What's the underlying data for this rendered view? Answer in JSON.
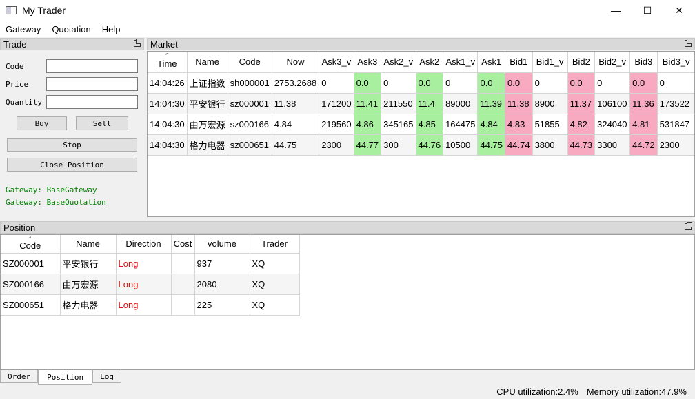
{
  "window": {
    "title": "My Trader",
    "minimize": "—",
    "maximize": "☐",
    "close": "✕"
  },
  "menu": [
    "Gateway",
    "Quotation",
    "Help"
  ],
  "trade": {
    "title": "Trade",
    "code_label": "Code",
    "price_label": "Price",
    "quantity_label": "Quantity",
    "code_value": "",
    "price_value": "",
    "quantity_value": "",
    "buy_label": "Buy",
    "sell_label": "Sell",
    "stop_label": "Stop",
    "close_position_label": "Close Position",
    "gateway_lines": [
      "Gateway: BaseGateway",
      "Gateway: BaseQuotation"
    ]
  },
  "market": {
    "title": "Market",
    "columns": [
      "Time",
      "Name",
      "Code",
      "Now",
      "Ask3_v",
      "Ask3",
      "Ask2_v",
      "Ask2",
      "Ask1_v",
      "Ask1",
      "Bid1",
      "Bid1_v",
      "Bid2",
      "Bid2_v",
      "Bid3",
      "Bid3_v"
    ],
    "rows": [
      [
        "14:04:26",
        "上证指数",
        "sh000001",
        "2753.2688",
        "0",
        "0.0",
        "0",
        "0.0",
        "0",
        "0.0",
        "0.0",
        "0",
        "0.0",
        "0",
        "0.0",
        "0"
      ],
      [
        "14:04:30",
        "平安银行",
        "sz000001",
        "11.38",
        "171200",
        "11.41",
        "211550",
        "11.4",
        "89000",
        "11.39",
        "11.38",
        "8900",
        "11.37",
        "106100",
        "11.36",
        "173522"
      ],
      [
        "14:04:30",
        "由万宏源",
        "sz000166",
        "4.84",
        "219560",
        "4.86",
        "345165",
        "4.85",
        "164475",
        "4.84",
        "4.83",
        "51855",
        "4.82",
        "324040",
        "4.81",
        "531847"
      ],
      [
        "14:04:30",
        "格力电器",
        "sz000651",
        "44.75",
        "2300",
        "44.77",
        "300",
        "44.76",
        "10500",
        "44.75",
        "44.74",
        "3800",
        "44.73",
        "3300",
        "44.72",
        "2300"
      ]
    ],
    "ask_color": "#a8f0a0",
    "bid_color": "#f7aac0"
  },
  "position": {
    "title": "Position",
    "columns": [
      "Code",
      "Name",
      "Direction",
      "Cost",
      "volume",
      "Trader"
    ],
    "rows": [
      [
        "SZ000001",
        "平安银行",
        "Long",
        "",
        "937",
        "XQ"
      ],
      [
        "SZ000166",
        "由万宏源",
        "Long",
        "",
        "2080",
        "XQ"
      ],
      [
        "SZ000651",
        "格力电器",
        "Long",
        "",
        "225",
        "XQ"
      ]
    ],
    "long_color": "#e01010"
  },
  "tabs": [
    "Order",
    "Position",
    "Log"
  ],
  "active_tab": "Position",
  "status": {
    "cpu": "CPU utilization:2.4%",
    "memory": "Memory utilization:47.9%"
  }
}
